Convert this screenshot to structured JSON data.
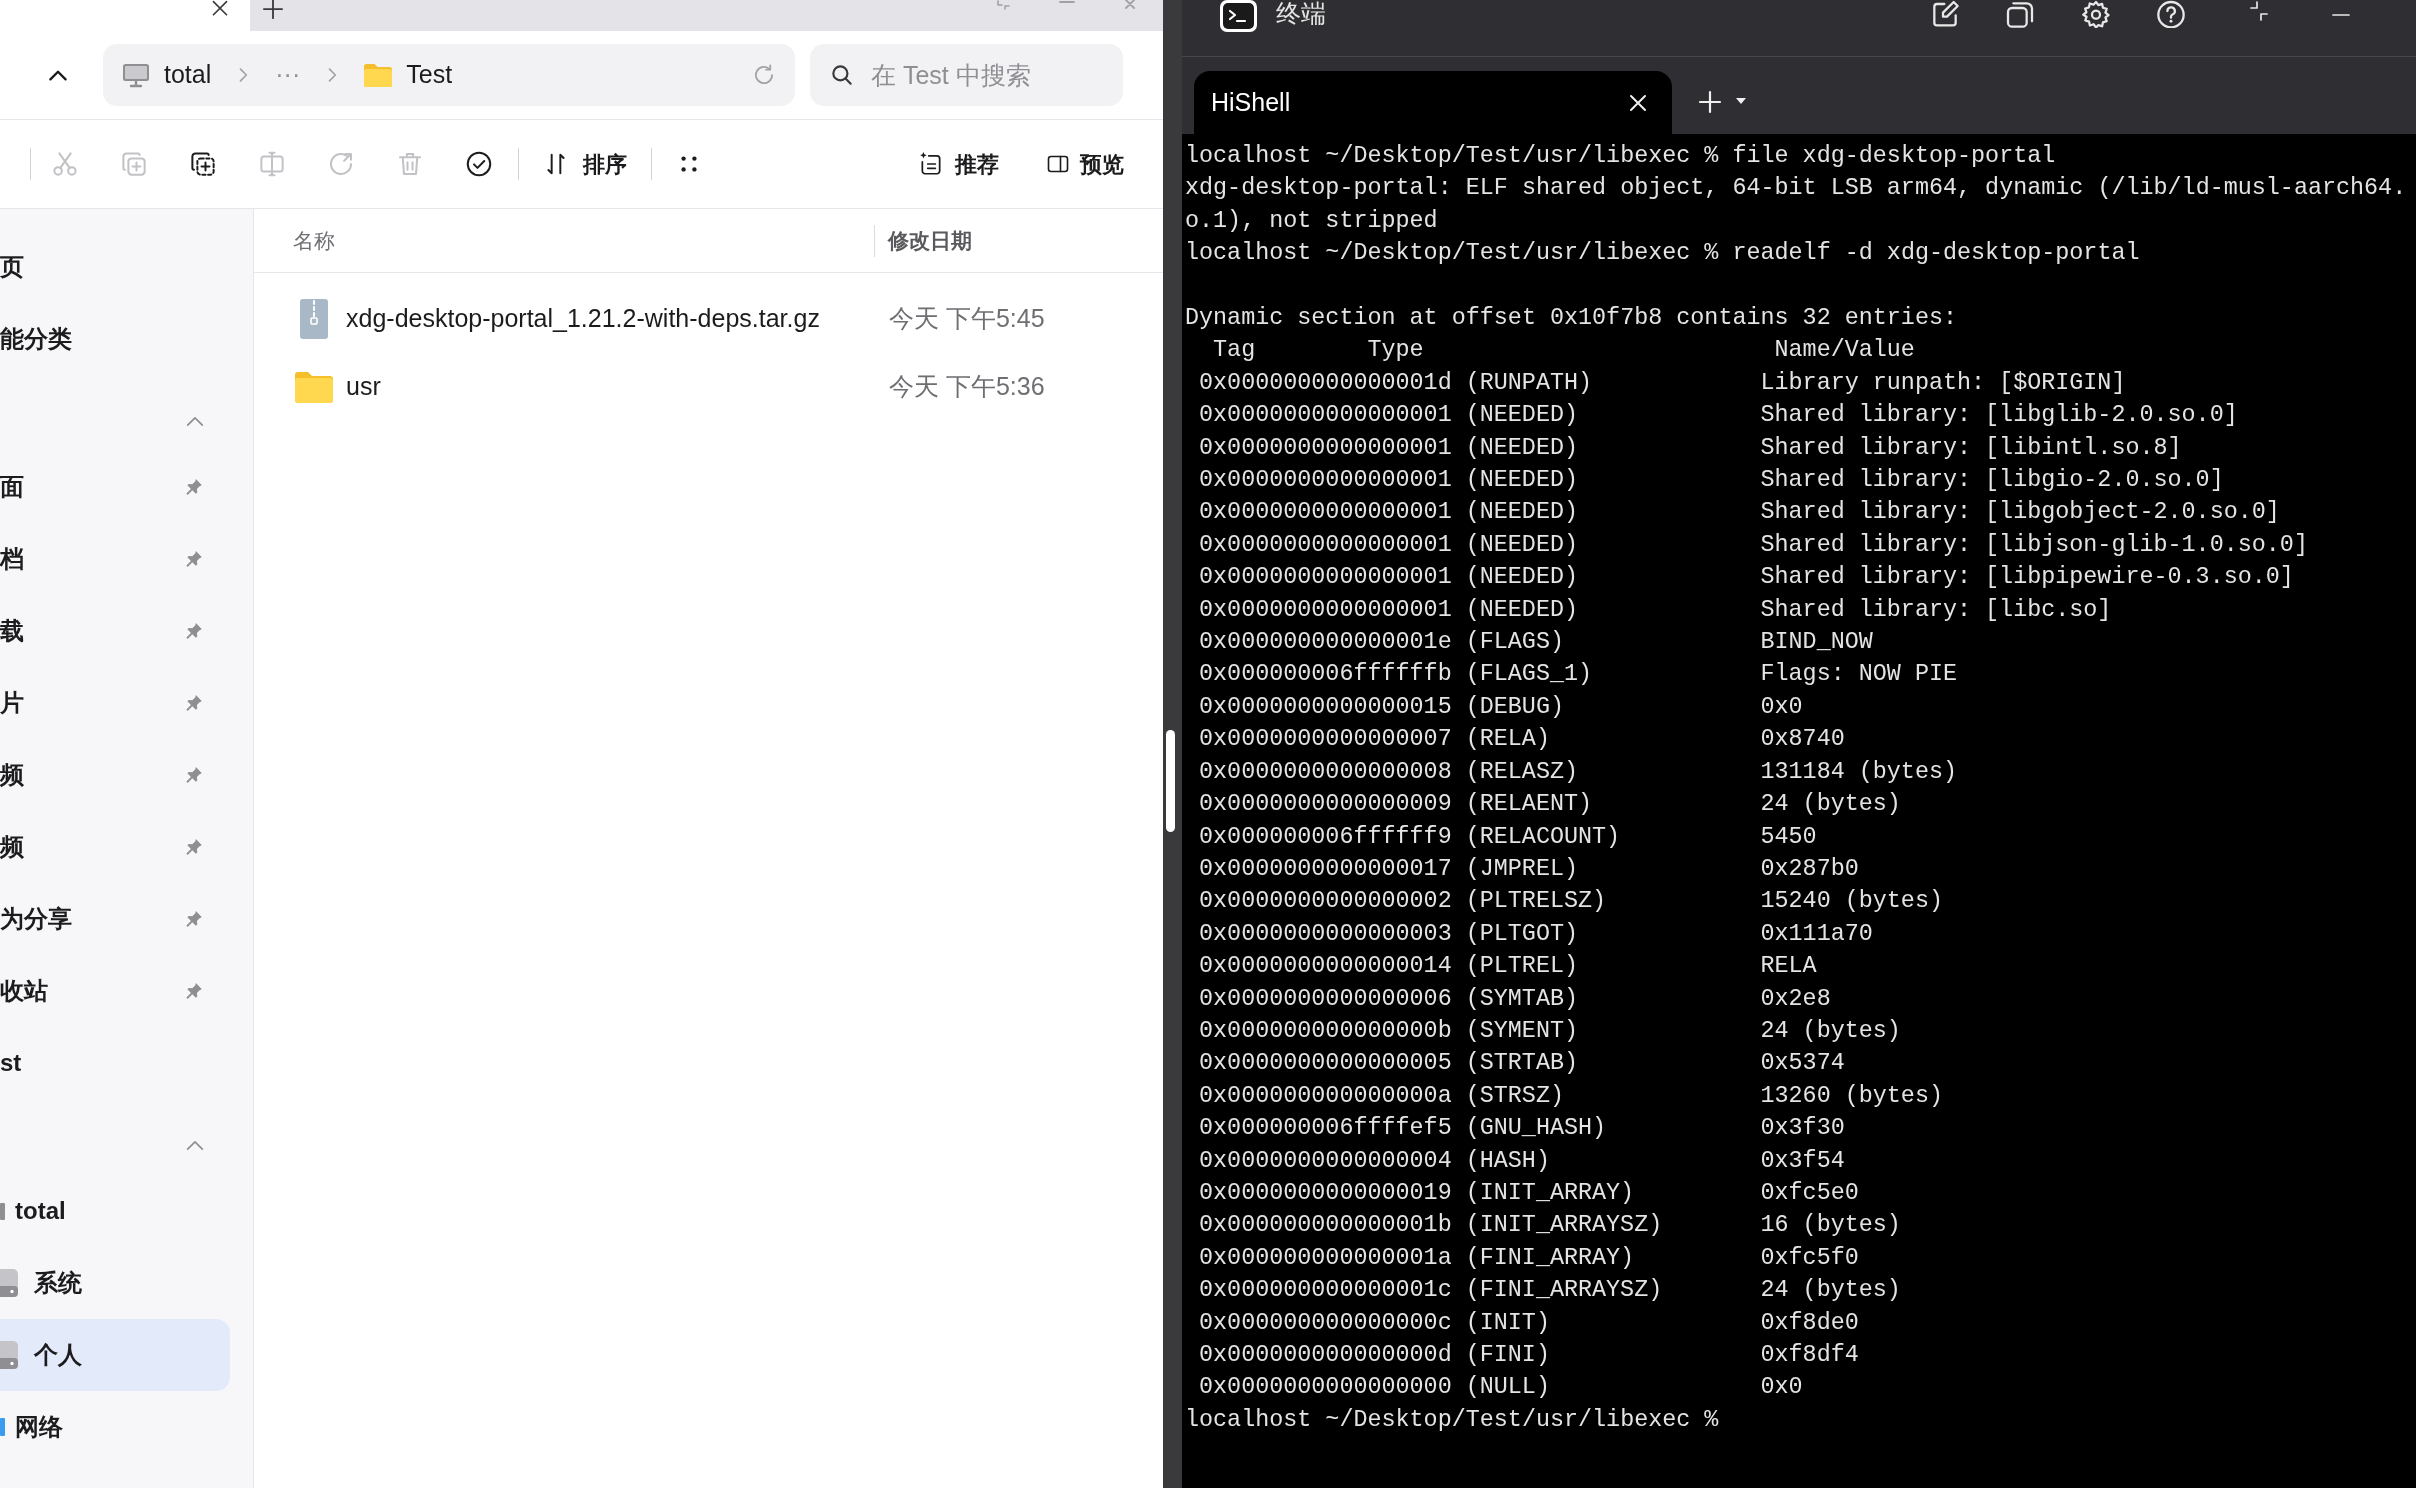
{
  "file_manager": {
    "tabs": [
      {
        "selected": true
      }
    ],
    "address_bar": {
      "segments": [
        {
          "kind": "computer",
          "label": "total"
        },
        {
          "kind": "more",
          "label": "···"
        },
        {
          "kind": "folder",
          "label": "Test"
        }
      ]
    },
    "search": {
      "placeholder": "在 Test 中搜索"
    },
    "toolbar": {
      "actions": [
        {
          "disabled": true
        },
        {
          "disabled": true
        },
        {
          "disabled": false
        },
        {
          "disabled": true
        },
        {
          "disabled": true
        },
        {
          "disabled": true
        },
        {
          "disabled": false
        }
      ],
      "sort": {
        "label": "排序"
      },
      "recommend": {
        "label": "推荐"
      },
      "preview": {
        "label": "预览"
      }
    },
    "sidebar": {
      "groups": [
        {
          "items": [
            {
              "label": "页",
              "selected": false
            },
            {
              "label": "能分类",
              "selected": false
            }
          ]
        },
        {
          "expanded": true,
          "items": [
            {
              "label": "面",
              "pinned": true,
              "selected": false
            },
            {
              "label": "档",
              "pinned": true,
              "selected": false
            },
            {
              "label": "载",
              "pinned": true,
              "selected": false
            },
            {
              "label": "片",
              "pinned": true,
              "selected": false
            },
            {
              "label": "频",
              "pinned": true,
              "selected": false
            },
            {
              "label": "频",
              "pinned": true,
              "selected": false
            },
            {
              "label": "为分享",
              "pinned": true,
              "selected": false
            },
            {
              "label": "收站",
              "pinned": true,
              "selected": false
            },
            {
              "label": "st",
              "pinned": false,
              "selected": false
            }
          ]
        },
        {
          "expanded": true,
          "items": [
            {
              "kind": "computer",
              "label": "total",
              "selected": false
            },
            {
              "kind": "drive",
              "label": "系统",
              "selected": false
            },
            {
              "kind": "drive",
              "label": "个人",
              "selected": true
            },
            {
              "kind": "network",
              "label": "网络",
              "selected": false
            }
          ]
        }
      ]
    },
    "file_list": {
      "columns": [
        "名称",
        "修改日期"
      ],
      "rows": [
        {
          "kind": "archive",
          "name": "xdg-desktop-portal_1.21.2-with-deps.tar.gz",
          "modified": "今天 下午5:45",
          "selected": false
        },
        {
          "kind": "folder",
          "name": "usr",
          "modified": "今天 下午5:36",
          "selected": false
        }
      ]
    }
  },
  "terminal": {
    "title": "终端",
    "tabs": [
      {
        "title": "HiShell",
        "selected": true
      }
    ],
    "sessions": [
      {
        "prompt": "localhost ~/Desktop/Test/usr/libexec %",
        "command": "file xdg-desktop-portal",
        "output": [
          "xdg-desktop-portal: ELF shared object, 64-bit LSB arm64, dynamic (/lib/ld-musl-aarch64.",
          "o.1), not stripped"
        ]
      },
      {
        "prompt": "localhost ~/Desktop/Test/usr/libexec %",
        "command": "readelf -d xdg-desktop-portal",
        "dynamic_section": {
          "heading": "Dynamic section at offset 0x10f7b8 contains 32 entries:",
          "columns": [
            "Tag",
            "Type",
            "Name/Value"
          ],
          "entries": [
            {
              "tag": "0x000000000000001d",
              "type": "(RUNPATH)",
              "value": "Library runpath: [$ORIGIN]"
            },
            {
              "tag": "0x0000000000000001",
              "type": "(NEEDED)",
              "value": "Shared library: [libglib-2.0.so.0]"
            },
            {
              "tag": "0x0000000000000001",
              "type": "(NEEDED)",
              "value": "Shared library: [libintl.so.8]"
            },
            {
              "tag": "0x0000000000000001",
              "type": "(NEEDED)",
              "value": "Shared library: [libgio-2.0.so.0]"
            },
            {
              "tag": "0x0000000000000001",
              "type": "(NEEDED)",
              "value": "Shared library: [libgobject-2.0.so.0]"
            },
            {
              "tag": "0x0000000000000001",
              "type": "(NEEDED)",
              "value": "Shared library: [libjson-glib-1.0.so.0]"
            },
            {
              "tag": "0x0000000000000001",
              "type": "(NEEDED)",
              "value": "Shared library: [libpipewire-0.3.so.0]"
            },
            {
              "tag": "0x0000000000000001",
              "type": "(NEEDED)",
              "value": "Shared library: [libc.so]"
            },
            {
              "tag": "0x000000000000001e",
              "type": "(FLAGS)",
              "value": "BIND_NOW"
            },
            {
              "tag": "0x000000006ffffffb",
              "type": "(FLAGS_1)",
              "value": "Flags: NOW PIE"
            },
            {
              "tag": "0x0000000000000015",
              "type": "(DEBUG)",
              "value": "0x0"
            },
            {
              "tag": "0x0000000000000007",
              "type": "(RELA)",
              "value": "0x8740"
            },
            {
              "tag": "0x0000000000000008",
              "type": "(RELASZ)",
              "value": "131184 (bytes)"
            },
            {
              "tag": "0x0000000000000009",
              "type": "(RELAENT)",
              "value": "24 (bytes)"
            },
            {
              "tag": "0x000000006ffffff9",
              "type": "(RELACOUNT)",
              "value": "5450"
            },
            {
              "tag": "0x0000000000000017",
              "type": "(JMPREL)",
              "value": "0x287b0"
            },
            {
              "tag": "0x0000000000000002",
              "type": "(PLTRELSZ)",
              "value": "15240 (bytes)"
            },
            {
              "tag": "0x0000000000000003",
              "type": "(PLTGOT)",
              "value": "0x111a70"
            },
            {
              "tag": "0x0000000000000014",
              "type": "(PLTREL)",
              "value": "RELA"
            },
            {
              "tag": "0x0000000000000006",
              "type": "(SYMTAB)",
              "value": "0x2e8"
            },
            {
              "tag": "0x000000000000000b",
              "type": "(SYMENT)",
              "value": "24 (bytes)"
            },
            {
              "tag": "0x0000000000000005",
              "type": "(STRTAB)",
              "value": "0x5374"
            },
            {
              "tag": "0x000000000000000a",
              "type": "(STRSZ)",
              "value": "13260 (bytes)"
            },
            {
              "tag": "0x000000006ffffef5",
              "type": "(GNU_HASH)",
              "value": "0x3f30"
            },
            {
              "tag": "0x0000000000000004",
              "type": "(HASH)",
              "value": "0x3f54"
            },
            {
              "tag": "0x0000000000000019",
              "type": "(INIT_ARRAY)",
              "value": "0xfc5e0"
            },
            {
              "tag": "0x000000000000001b",
              "type": "(INIT_ARRAYSZ)",
              "value": "16 (bytes)"
            },
            {
              "tag": "0x000000000000001a",
              "type": "(FINI_ARRAY)",
              "value": "0xfc5f0"
            },
            {
              "tag": "0x000000000000001c",
              "type": "(FINI_ARRAYSZ)",
              "value": "24 (bytes)"
            },
            {
              "tag": "0x000000000000000c",
              "type": "(INIT)",
              "value": "0xf8de0"
            },
            {
              "tag": "0x000000000000000d",
              "type": "(FINI)",
              "value": "0xf8df4"
            },
            {
              "tag": "0x0000000000000000",
              "type": "(NULL)",
              "value": "0x0"
            }
          ]
        }
      },
      {
        "prompt": "localhost ~/Desktop/Test/usr/libexec %"
      }
    ]
  }
}
